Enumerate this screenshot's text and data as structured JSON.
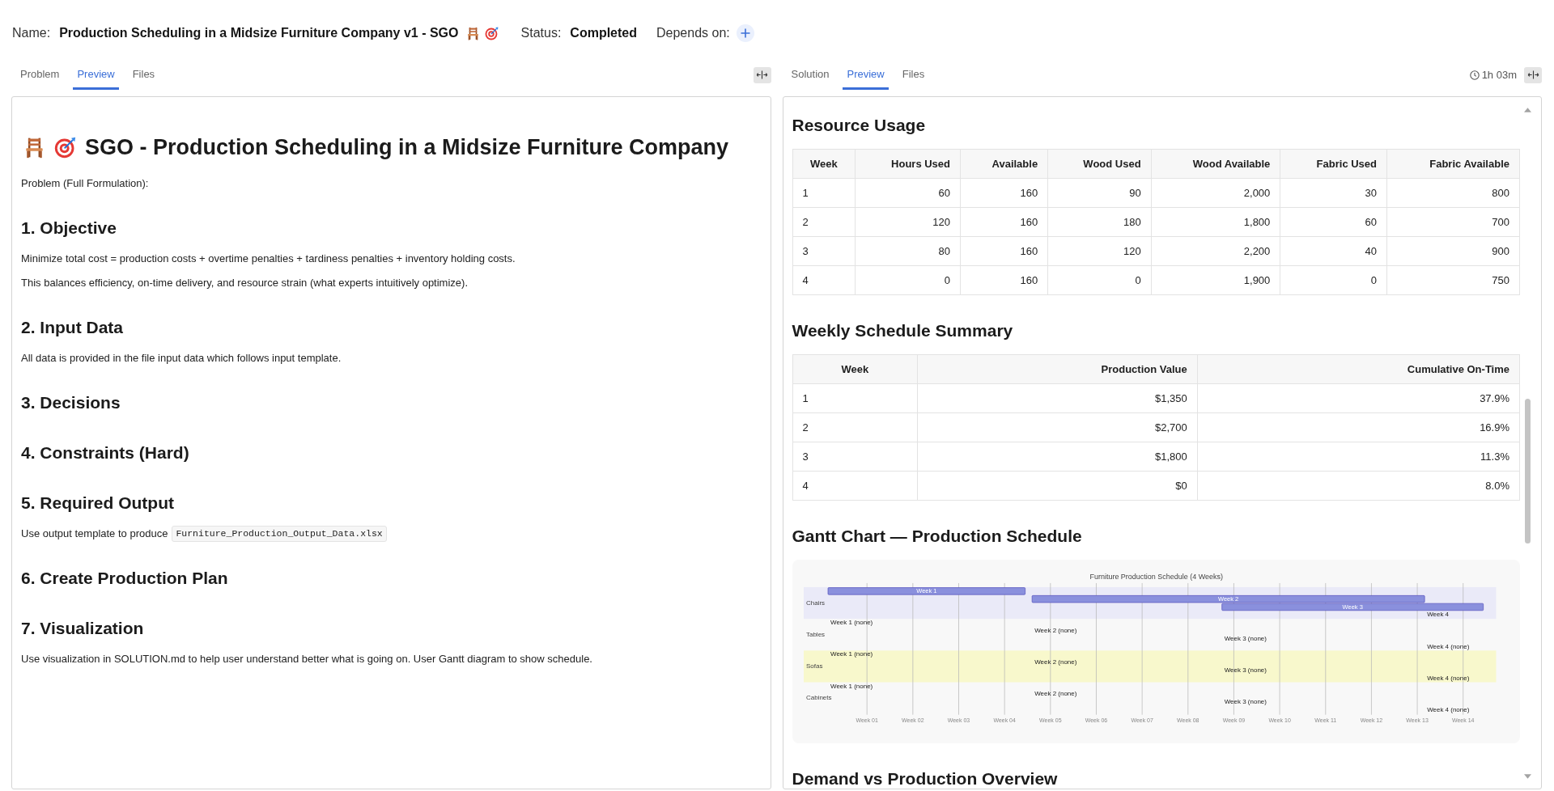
{
  "header": {
    "name_label": "Name:",
    "name": "Production Scheduling in a Midsize Furniture Company v1 - SGO",
    "status_label": "Status:",
    "status": "Completed",
    "depends_label": "Depends on:"
  },
  "left_panel": {
    "tabs": [
      {
        "label": "Problem",
        "selected": false
      },
      {
        "label": "Preview",
        "selected": true
      },
      {
        "label": "Files",
        "selected": false
      }
    ],
    "title": "SGO - Production Scheduling in a Midsize Furniture Company",
    "blocks": [
      {
        "kind": "paragraph",
        "text": "Problem (Full Formulation):"
      },
      {
        "kind": "heading",
        "text": "1. Objective"
      },
      {
        "kind": "paragraph",
        "text": "Minimize total cost = production costs + overtime penalties + tardiness penalties + inventory holding costs."
      },
      {
        "kind": "paragraph",
        "text": "This balances efficiency, on-time delivery, and resource strain (what experts intuitively optimize)."
      },
      {
        "kind": "heading",
        "text": "2. Input Data"
      },
      {
        "kind": "paragraph",
        "text": "All data is provided in the file input data which follows input template."
      },
      {
        "kind": "heading",
        "text": "3. Decisions"
      },
      {
        "kind": "heading",
        "text": "4. Constraints (Hard)"
      },
      {
        "kind": "heading",
        "text": "5. Required Output"
      },
      {
        "kind": "code_paragraph",
        "text": "Use output template to produce",
        "code": "Furniture_Production_Output_Data.xlsx"
      },
      {
        "kind": "heading",
        "text": "6. Create Production Plan"
      },
      {
        "kind": "heading",
        "text": "7. Visualization"
      },
      {
        "kind": "paragraph",
        "text": "Use visualization in SOLUTION.md to help user understand better what is going on. User Gantt diagram to show schedule."
      }
    ]
  },
  "right_panel": {
    "tabs": [
      {
        "label": "Solution",
        "selected": false
      },
      {
        "label": "Preview",
        "selected": true
      },
      {
        "label": "Files",
        "selected": false
      }
    ],
    "elapsed": "1h 03m",
    "sections": [
      {
        "kind": "table",
        "title": "Resource Usage",
        "columns": [
          "Week",
          "Hours Used",
          "Available",
          "Wood Used",
          "Wood Available",
          "Fabric Used",
          "Fabric Available"
        ],
        "rows": [
          [
            "1",
            "60",
            "160",
            "90",
            "2,000",
            "30",
            "800"
          ],
          [
            "2",
            "120",
            "160",
            "180",
            "1,800",
            "60",
            "700"
          ],
          [
            "3",
            "80",
            "160",
            "120",
            "2,200",
            "40",
            "900"
          ],
          [
            "4",
            "0",
            "160",
            "0",
            "1,900",
            "0",
            "750"
          ]
        ]
      },
      {
        "kind": "table",
        "title": "Weekly Schedule Summary",
        "columns": [
          "Week",
          "Production Value",
          "Cumulative On-Time"
        ],
        "rows": [
          [
            "1",
            "$1,350",
            "37.9%"
          ],
          [
            "2",
            "$2,700",
            "16.9%"
          ],
          [
            "3",
            "$1,800",
            "11.3%"
          ],
          [
            "4",
            "$0",
            "8.0%"
          ]
        ]
      },
      {
        "kind": "gantt",
        "title": "Gantt Chart — Production Schedule",
        "gantt": {
          "title": "Furniture Production Schedule (4 Weeks)",
          "sections": [
            {
              "label": "Chairs",
              "color": "#eaeaf8",
              "tasks": [
                {
                  "label": "Week 1",
                  "kind": "bar"
                },
                {
                  "label": "Week 2",
                  "kind": "bar"
                },
                {
                  "label": "Week 3",
                  "kind": "bar"
                },
                {
                  "label": "Week 4",
                  "kind": "point"
                }
              ]
            },
            {
              "label": "Tables",
              "tasks": [
                {
                  "label": "Week 1 (none)",
                  "kind": "point"
                },
                {
                  "label": "Week 2 (none)",
                  "kind": "point"
                },
                {
                  "label": "Week 3 (none)",
                  "kind": "point"
                },
                {
                  "label": "Week 4 (none)",
                  "kind": "point"
                }
              ]
            },
            {
              "label": "Sofas",
              "color": "#f8f8cc",
              "tasks": [
                {
                  "label": "Week 1 (none)",
                  "kind": "point"
                },
                {
                  "label": "Week 2 (none)",
                  "kind": "point"
                },
                {
                  "label": "Week 3 (none)",
                  "kind": "point"
                },
                {
                  "label": "Week 4 (none)",
                  "kind": "point"
                }
              ]
            },
            {
              "label": "Cabinets",
              "tasks": [
                {
                  "label": "Week 1 (none)",
                  "kind": "point"
                },
                {
                  "label": "Week 2 (none)",
                  "kind": "point"
                },
                {
                  "label": "Week 3 (none)",
                  "kind": "point"
                },
                {
                  "label": "Week 4 (none)",
                  "kind": "point"
                }
              ]
            }
          ],
          "axis_labels": [
            "Week 01",
            "Week 02",
            "Week 03",
            "Week 04",
            "Week 05",
            "Week 06",
            "Week 07",
            "Week 08",
            "Week 09",
            "Week 10",
            "Week 11",
            "Week 12",
            "Week 13",
            "Week 14"
          ]
        }
      },
      {
        "kind": "heading",
        "title": "Demand vs Production Overview"
      }
    ]
  }
}
